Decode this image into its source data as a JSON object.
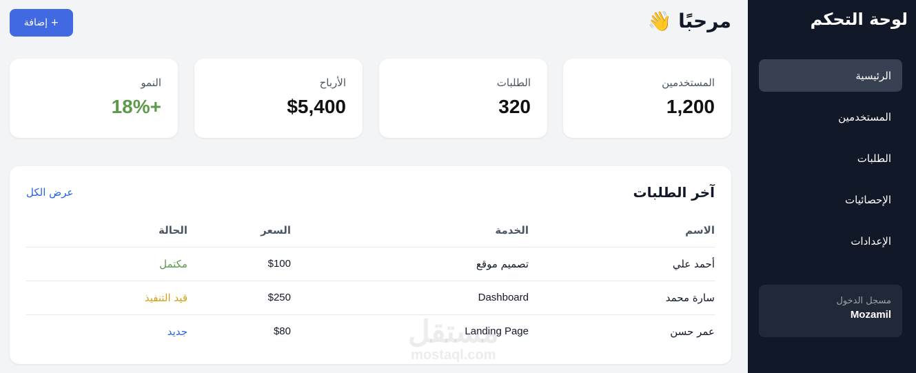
{
  "sidebar": {
    "title": "لوحة التحكم",
    "items": [
      {
        "label": "الرئيسية",
        "active": true
      },
      {
        "label": "المستخدمين"
      },
      {
        "label": "الطلبات"
      },
      {
        "label": "الإحصائيات"
      },
      {
        "label": "الإعدادات"
      }
    ],
    "user": {
      "label": "مسجل الدخول",
      "name": "Mozamil"
    }
  },
  "header": {
    "greeting": "مرحبًا 👋",
    "add_button": "+ إضافة"
  },
  "stats": [
    {
      "label": "المستخدمين",
      "value": "1,200"
    },
    {
      "label": "الطلبات",
      "value": "320"
    },
    {
      "label": "الأرباح",
      "value": "$5,400"
    },
    {
      "label": "النمو",
      "value": "+18%"
    }
  ],
  "orders": {
    "title": "آخر الطلبات",
    "view_all": "عرض الكل",
    "columns": [
      "الاسم",
      "الخدمة",
      "السعر",
      "الحالة"
    ],
    "rows": [
      {
        "name": "أحمد علي",
        "service": "تصميم موقع",
        "price": "$100",
        "status": "مكتمل"
      },
      {
        "name": "سارة محمد",
        "service": "Dashboard",
        "price": "$250",
        "status": "قيد التنفيذ"
      },
      {
        "name": "عمر حسن",
        "service": "Landing Page",
        "price": "$80",
        "status": "جديد"
      }
    ]
  },
  "colors": {
    "sidebar_bg": "#111827",
    "accent": "#4169e1",
    "status_complete": "#5b9a4a",
    "status_progress": "#d4a017",
    "status_new": "#2563eb"
  },
  "watermark": {
    "logo": "مستقل",
    "url": "mostaql.com"
  }
}
